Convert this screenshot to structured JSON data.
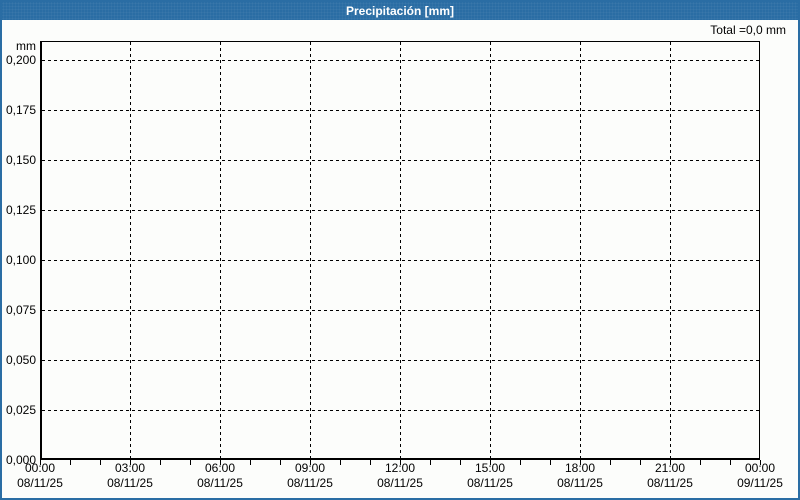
{
  "header": {
    "title": "Precipitación [mm]"
  },
  "summary": {
    "total_label": "Total =0,0 mm"
  },
  "colors": {
    "accent_blue": "#2A6DA4",
    "background": "#FCFDFB",
    "grid": "#000000",
    "text": "#000000",
    "title_text": "#FFFFFF"
  },
  "chart_data": {
    "type": "bar",
    "title": "Precipitación [mm]",
    "y_unit": "mm",
    "ylabel": "mm",
    "ylim": [
      0,
      0.21
    ],
    "y_ticks_labels": [
      "0,200",
      "0,175",
      "0,150",
      "0,125",
      "0,100",
      "0,075",
      "0,050",
      "0,025",
      "0,000"
    ],
    "y_tick_values": [
      0.2,
      0.175,
      0.15,
      0.125,
      0.1,
      0.075,
      0.05,
      0.025,
      0.0
    ],
    "x_ticks": [
      {
        "time": "00:00",
        "date": "08/11/25"
      },
      {
        "time": "03:00",
        "date": "08/11/25"
      },
      {
        "time": "06:00",
        "date": "08/11/25"
      },
      {
        "time": "09:00",
        "date": "08/11/25"
      },
      {
        "time": "12:00",
        "date": "08/11/25"
      },
      {
        "time": "15:00",
        "date": "08/11/25"
      },
      {
        "time": "18:00",
        "date": "08/11/25"
      },
      {
        "time": "21:00",
        "date": "08/11/25"
      },
      {
        "time": "00:00",
        "date": "09/11/25"
      }
    ],
    "x_major_interval_hours": 3,
    "x_minor_tick_hours": 1,
    "grid": {
      "style": "dashed",
      "horizontal": true,
      "vertical": true
    },
    "legend": "none",
    "series": [
      {
        "name": "Precipitación",
        "values": [],
        "total": "0,0 mm"
      }
    ],
    "total_value": "0,0 mm"
  }
}
